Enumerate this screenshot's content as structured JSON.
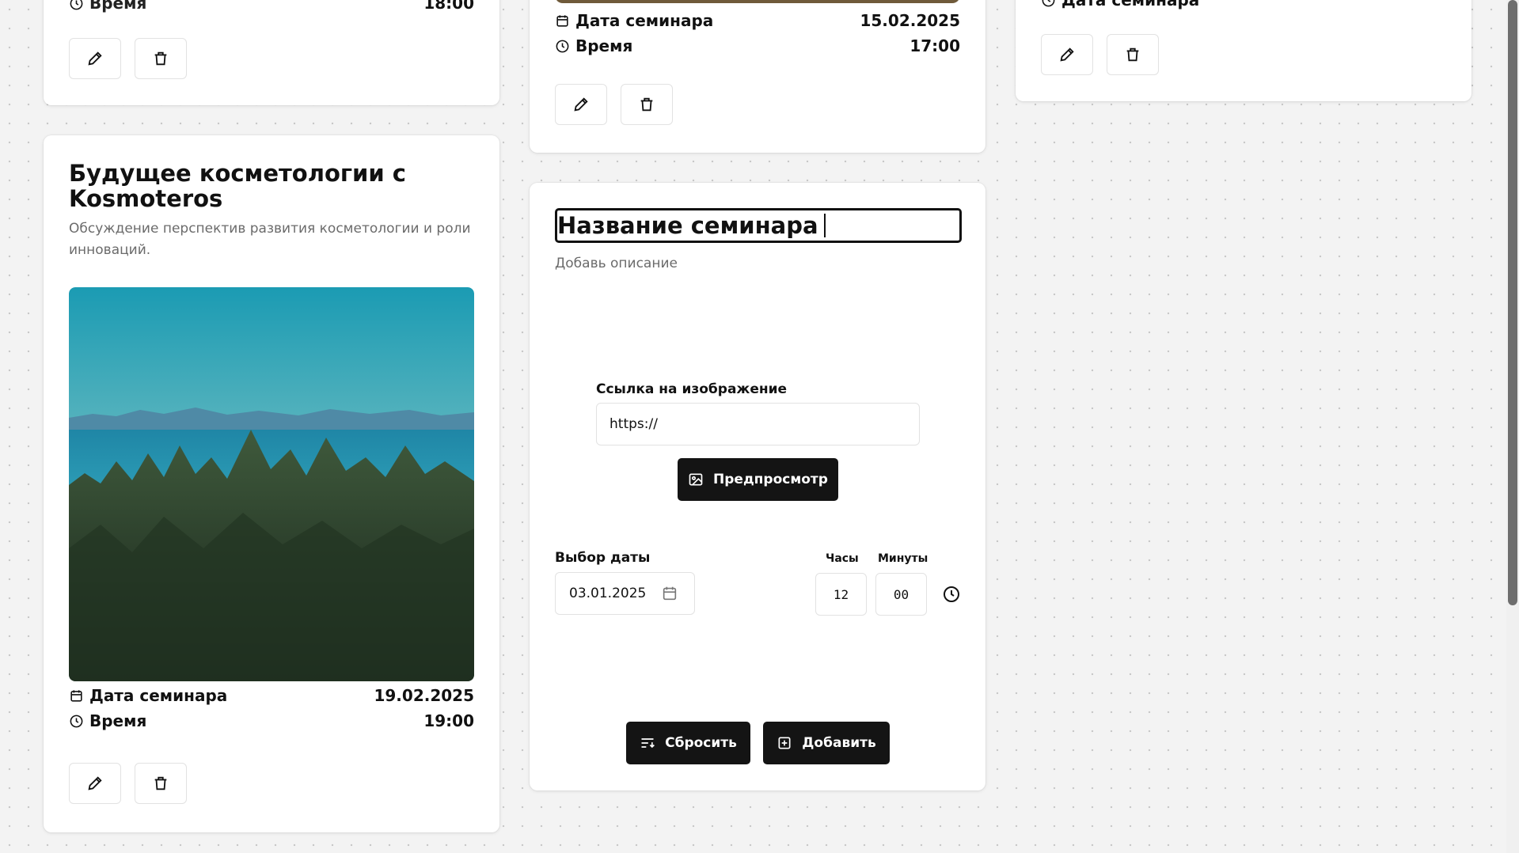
{
  "cards": {
    "top_left": {
      "time_label": "Время",
      "time_value": "18:00"
    },
    "top_middle": {
      "date_label": "Дата семинара",
      "date_value": "15.02.2025",
      "time_label": "Время",
      "time_value": "17:00"
    },
    "top_right": {
      "date_label": "Дата семинара"
    },
    "bottom_left": {
      "title": "Будущее косметологии с Kosmoteros",
      "description": "Обсуждение перспектив развития косметологии и роли инноваций.",
      "date_label": "Дата семинара",
      "date_value": "19.02.2025",
      "time_label": "Время",
      "time_value": "19:00"
    }
  },
  "form": {
    "title_value": "Название семинара",
    "description_placeholder": "Добавь описание",
    "image_link_label": "Ссылка на изображение",
    "image_link_value": "https://",
    "preview_button": "Предпросмотр",
    "date_label": "Выбор даты",
    "date_value": "03.01.2025",
    "hours_label": "Часы",
    "minutes_label": "Минуты",
    "hours_value": "12",
    "minutes_value": "00",
    "reset_button": "Сбросить",
    "add_button": "Добавить"
  },
  "icons": [
    "pencil-icon",
    "trash-icon",
    "calendar-icon",
    "clock-icon",
    "image-icon",
    "reset-icon",
    "plus-square-icon"
  ]
}
